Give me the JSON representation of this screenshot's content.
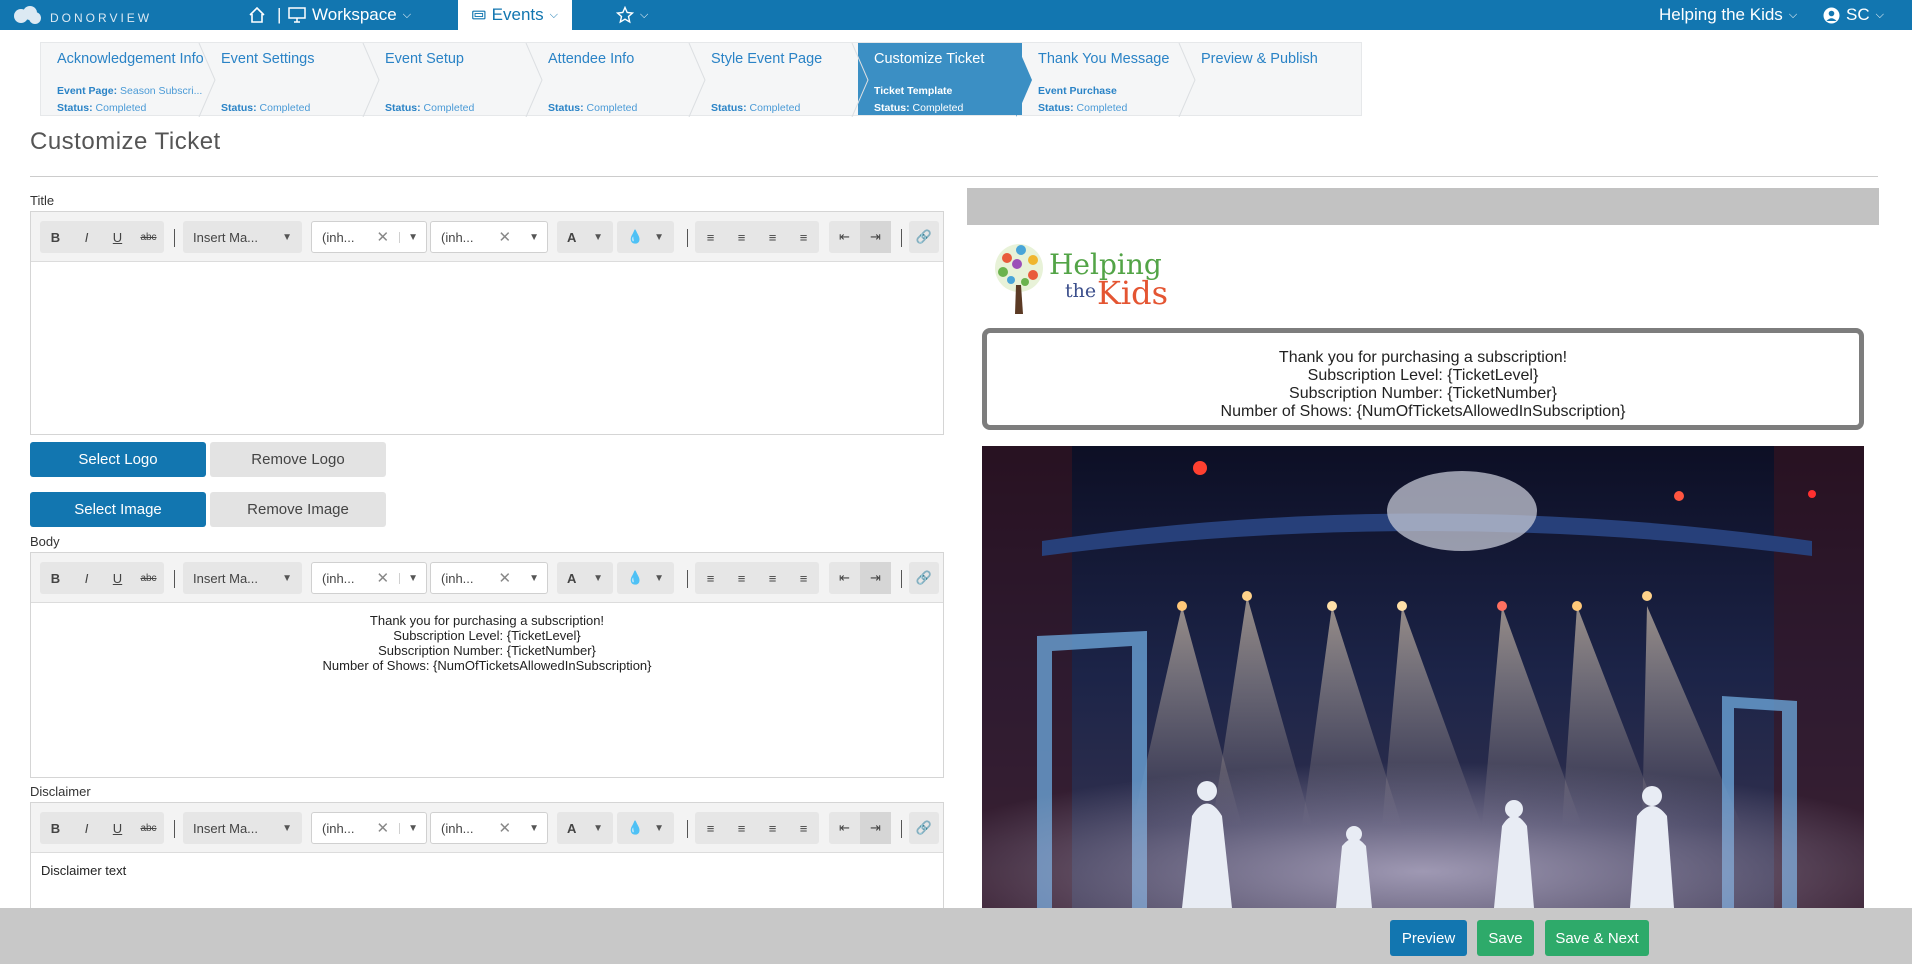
{
  "nav": {
    "brand": "DONORVIEW",
    "workspace": "Workspace",
    "events": "Events",
    "org": "Helping the Kids",
    "user": "SC"
  },
  "steps": [
    {
      "title": "Acknowledgement Info",
      "sub1_label": "Event Page:",
      "sub1_value": "Season Subscri...",
      "status_label": "Status:",
      "status": "Completed"
    },
    {
      "title": "Event Settings",
      "status_label": "Status:",
      "status": "Completed"
    },
    {
      "title": "Event Setup",
      "status_label": "Status:",
      "status": "Completed"
    },
    {
      "title": "Attendee Info",
      "status_label": "Status:",
      "status": "Completed"
    },
    {
      "title": "Style Event Page",
      "status_label": "Status:",
      "status": "Completed"
    },
    {
      "title": "Customize Ticket",
      "sub1_label": "Ticket Template",
      "status_label": "Status:",
      "status": "Completed"
    },
    {
      "title": "Thank You Message",
      "sub1_label": "Event Purchase",
      "status_label": "Status:",
      "status": "Completed"
    },
    {
      "title": "Preview & Publish"
    }
  ],
  "page": {
    "title": "Customize Ticket"
  },
  "labels": {
    "title": "Title",
    "body": "Body",
    "disclaimer": "Disclaimer"
  },
  "toolbar": {
    "bold": "B",
    "italic": "I",
    "underline": "U",
    "strike": "abc",
    "insert": "Insert Ma...",
    "font": "(inh...",
    "size": "(inh...",
    "color": "A"
  },
  "buttons": {
    "select_logo": "Select Logo",
    "remove_logo": "Remove Logo",
    "select_image": "Select Image",
    "remove_image": "Remove Image"
  },
  "body_text": [
    "Thank you for purchasing a subscription!",
    "Subscription Level: {TicketLevel}",
    "Subscription Number: {TicketNumber}",
    "Number of Shows: {NumOfTicketsAllowedInSubscription}"
  ],
  "disclaimer_text": "Disclaimer text",
  "logo": {
    "line1": "Helping",
    "line2a": "the",
    "line2b": "Kids"
  },
  "footer": {
    "preview": "Preview",
    "save": "Save",
    "save_next": "Save & Next"
  },
  "colors": {
    "primary": "#1276b0",
    "success": "#2eaa6a",
    "active_step": "#3b8fc4"
  }
}
